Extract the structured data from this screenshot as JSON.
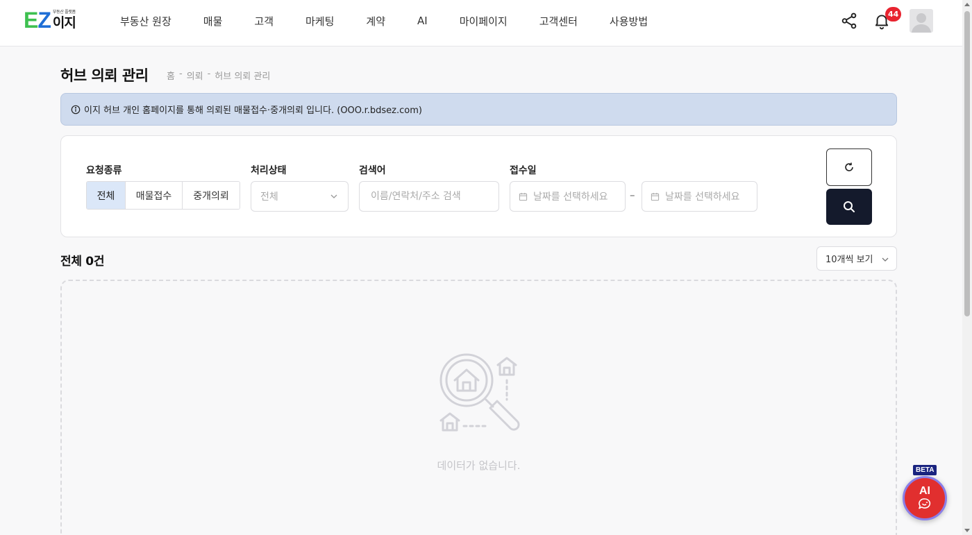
{
  "logo": {
    "e": "E",
    "z": "Z",
    "tagline": "부동산 플랫폼",
    "korean": "이지"
  },
  "nav": {
    "items": [
      "부동산 원장",
      "매물",
      "고객",
      "마케팅",
      "계약",
      "AI",
      "마이페이지",
      "고객센터",
      "사용방법"
    ]
  },
  "header": {
    "notification_count": "44"
  },
  "page": {
    "title": "허브 의뢰 관리",
    "breadcrumb": [
      "홈",
      "-",
      "의뢰",
      "-",
      "허브 의뢰 관리"
    ]
  },
  "info": {
    "text": "이지 허브 개인 홈페이지를 통해 의뢰된 매물접수·중개의뢰 입니다. (OOO.r.bdsez.com)"
  },
  "filter": {
    "request_type_label": "요청종류",
    "request_types": [
      "전체",
      "매물접수",
      "중개의뢰"
    ],
    "selected_request_type": "전체",
    "status_label": "처리상태",
    "status_value": "전체",
    "keyword_label": "검색어",
    "keyword_placeholder": "이름/연락처/주소 검색",
    "date_label": "접수일",
    "date_start_placeholder": "날짜를 선택하세요",
    "date_separator": "–",
    "date_end_placeholder": "날짜를 선택하세요"
  },
  "results": {
    "total_text": "전체 0건",
    "per_page": "10개씩 보기",
    "empty_text": "데이터가 없습니다."
  },
  "ai_fab": {
    "beta": "BETA",
    "label": "AI"
  },
  "colors": {
    "accent_navy": "#141a2c",
    "info_bg": "#cfdbee",
    "active_segment": "#dbe7f8",
    "badge_red": "#e8232f",
    "fab_red": "#e12f2f"
  }
}
